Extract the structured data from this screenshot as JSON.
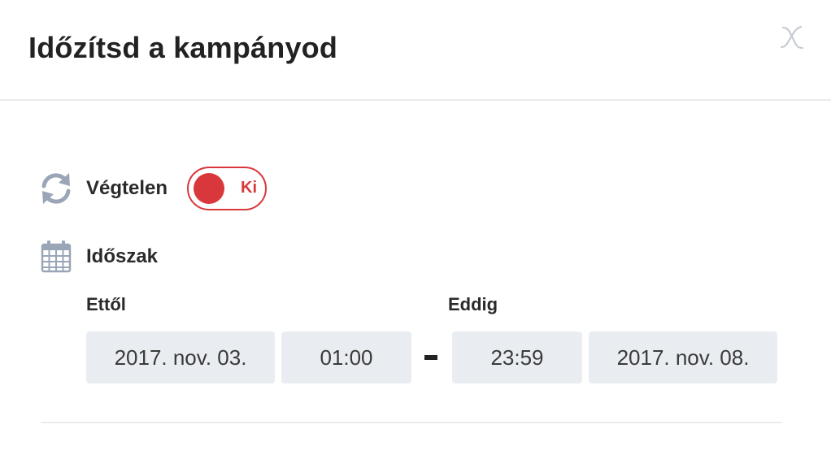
{
  "dialog": {
    "title": "Időzítsd a kampányod",
    "close_label": "X"
  },
  "endless": {
    "label": "Végtelen",
    "toggle_state": "Ki"
  },
  "period": {
    "label": "Időszak",
    "from_label": "Ettől",
    "to_label": "Eddig",
    "from_date": "2017. nov. 03.",
    "from_time": "01:00",
    "to_time": "23:59",
    "to_date": "2017. nov. 08.",
    "separator": "-"
  },
  "colors": {
    "accent_red": "#d8383c",
    "field_bg": "#e9edf1",
    "icon_gray": "#9aa6b8",
    "divider": "#e9ebee"
  },
  "icons": {
    "close": "close-icon",
    "endless": "refresh-icon",
    "period": "calendar-icon"
  }
}
